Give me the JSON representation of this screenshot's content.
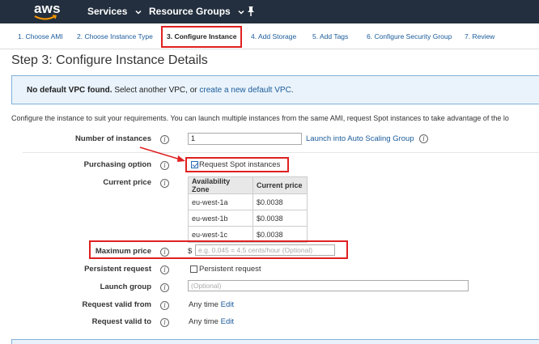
{
  "nav": {
    "logo": "aws",
    "services_label": "Services",
    "resource_groups_label": "Resource Groups",
    "pin_icon": "pin-icon"
  },
  "tabs": [
    {
      "label": "1. Choose AMI",
      "active": false
    },
    {
      "label": "2. Choose Instance Type",
      "active": false
    },
    {
      "label": "3. Configure Instance",
      "active": true
    },
    {
      "label": "4. Add Storage",
      "active": false
    },
    {
      "label": "5. Add Tags",
      "active": false
    },
    {
      "label": "6. Configure Security Group",
      "active": false
    },
    {
      "label": "7. Review",
      "active": false
    }
  ],
  "page_title": "Step 3: Configure Instance Details",
  "info": {
    "bold": "No default VPC found.",
    "text": " Select another VPC, or ",
    "link": "create a new default VPC",
    "suffix": "."
  },
  "description": "Configure the instance to suit your requirements. You can launch multiple instances from the same AMI, request Spot instances to take advantage of the lo",
  "form": {
    "number_of_instances": {
      "label": "Number of instances",
      "value": "1",
      "link": "Launch into Auto Scaling Group"
    },
    "purchasing_option": {
      "label": "Purchasing option",
      "checkbox_label": "Request Spot instances",
      "checked": true
    },
    "current_price": {
      "label": "Current price",
      "columns": [
        "Availability Zone",
        "Current price"
      ],
      "rows": [
        [
          "eu-west-1a",
          "$0.0038"
        ],
        [
          "eu-west-1b",
          "$0.0038"
        ],
        [
          "eu-west-1c",
          "$0.0038"
        ]
      ]
    },
    "maximum_price": {
      "label": "Maximum price",
      "currency": "$",
      "placeholder": "e.g. 0.045 = 4.5 cents/hour (Optional)"
    },
    "persistent_request": {
      "label": "Persistent request",
      "checkbox_label": "Persistent request",
      "checked": false
    },
    "launch_group": {
      "label": "Launch group",
      "placeholder": "(Optional)"
    },
    "request_valid_from": {
      "label": "Request valid from",
      "value": "Any time",
      "link": "Edit"
    },
    "request_valid_to": {
      "label": "Request valid to",
      "value": "Any time",
      "link": "Edit"
    }
  },
  "colors": {
    "nav_bg": "#232f3e",
    "link": "#1a5b9a",
    "highlight": "#e02020",
    "info_bg": "#eaf3fb"
  }
}
